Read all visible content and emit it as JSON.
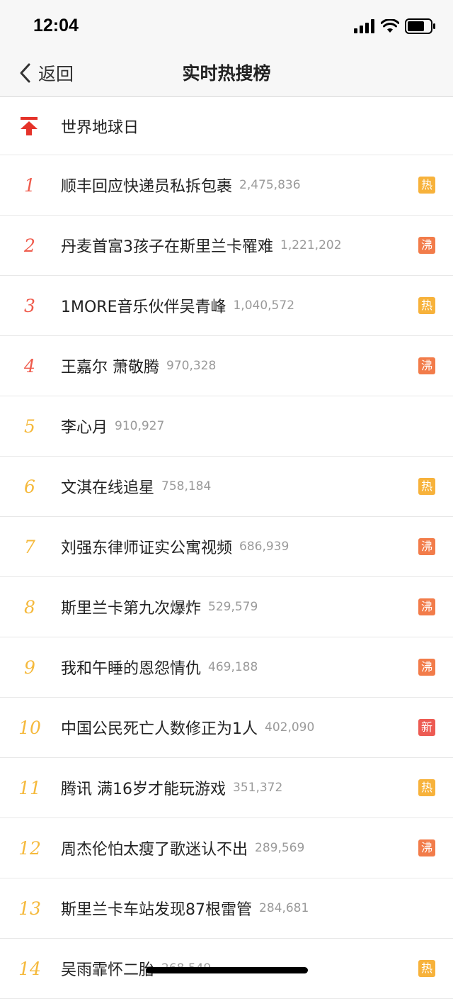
{
  "status_bar": {
    "time": "12:04"
  },
  "nav": {
    "back_label": "返回",
    "title": "实时热搜榜"
  },
  "pinned": {
    "title": "世界地球日"
  },
  "items": [
    {
      "rank": "1",
      "title": "顺丰回应快递员私拆包裹",
      "count": "2,475,836",
      "tag": "热"
    },
    {
      "rank": "2",
      "title": "丹麦首富3孩子在斯里兰卡罹难",
      "count": "1,221,202",
      "tag": "沸"
    },
    {
      "rank": "3",
      "title": "1MORE音乐伙伴吴青峰",
      "count": "1,040,572",
      "tag": "热"
    },
    {
      "rank": "4",
      "title": "王嘉尔 萧敬腾",
      "count": "970,328",
      "tag": "沸"
    },
    {
      "rank": "5",
      "title": "李心月",
      "count": "910,927",
      "tag": ""
    },
    {
      "rank": "6",
      "title": "文淇在线追星",
      "count": "758,184",
      "tag": "热"
    },
    {
      "rank": "7",
      "title": "刘强东律师证实公寓视频",
      "count": "686,939",
      "tag": "沸"
    },
    {
      "rank": "8",
      "title": "斯里兰卡第九次爆炸",
      "count": "529,579",
      "tag": "沸"
    },
    {
      "rank": "9",
      "title": "我和午睡的恩怨情仇",
      "count": "469,188",
      "tag": "沸"
    },
    {
      "rank": "10",
      "title": "中国公民死亡人数修正为1人",
      "count": "402,090",
      "tag": "新"
    },
    {
      "rank": "11",
      "title": "腾讯 满16岁才能玩游戏",
      "count": "351,372",
      "tag": "热"
    },
    {
      "rank": "12",
      "title": "周杰伦怕太瘦了歌迷认不出",
      "count": "289,569",
      "tag": "沸"
    },
    {
      "rank": "13",
      "title": "斯里兰卡车站发现87根雷管",
      "count": "284,681",
      "tag": ""
    },
    {
      "rank": "14",
      "title": "吴雨霏怀二胎",
      "count": "268,549",
      "tag": "热"
    }
  ],
  "colors": {
    "rank_top": "#ef5b4c",
    "rank_mid": "#f5b93c",
    "tag_hot": "#f7b23b",
    "tag_boil": "#f27c4a",
    "tag_new": "#ed5b53",
    "pin": "#e5332a"
  },
  "icons": {
    "back": "chevron-left-icon",
    "pin": "pin-to-top-icon",
    "signal": "cellular-signal-icon",
    "wifi": "wifi-icon",
    "battery": "battery-icon"
  }
}
